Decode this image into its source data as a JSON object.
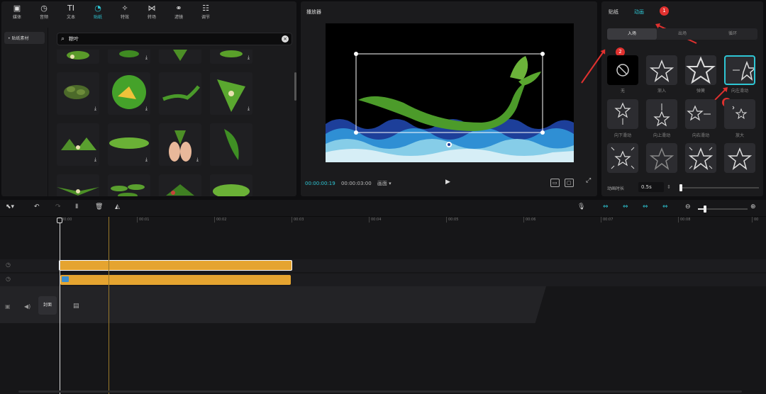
{
  "toolbar": {
    "items": [
      {
        "label": "媒体",
        "icon": "media-icon"
      },
      {
        "label": "音频",
        "icon": "audio-icon"
      },
      {
        "label": "文本",
        "icon": "text-icon"
      },
      {
        "label": "贴纸",
        "icon": "sticker-icon",
        "active": true
      },
      {
        "label": "特效",
        "icon": "effects-icon"
      },
      {
        "label": "转场",
        "icon": "transition-icon"
      },
      {
        "label": "滤镜",
        "icon": "filter-icon"
      },
      {
        "label": "调节",
        "icon": "adjust-icon"
      }
    ]
  },
  "sticker_panel": {
    "category": "• 贴纸素材",
    "search_value": "粽叶"
  },
  "player": {
    "title": "播放器",
    "current_time": "00:00:00:19",
    "total_time": "00:00:03:00",
    "ratio_label": "画面"
  },
  "right_panel": {
    "tabs": [
      "贴纸",
      "动画"
    ],
    "subtabs": [
      "入场",
      "出场",
      "循环"
    ],
    "animations": [
      "无",
      "渐入",
      "弹簧",
      "向左滑动",
      "向下滑动",
      "向上滑动",
      "向右滑动",
      "放大",
      "",
      "",
      "",
      ""
    ],
    "duration_label": "动画时长",
    "duration_value": "0.5s",
    "duration_fraction": 0.0,
    "badges": [
      "1",
      "2",
      "3"
    ]
  },
  "timeline": {
    "ruler": [
      "00:00",
      "00:01",
      "00:02",
      "00:03",
      "00:04",
      "00:05",
      "00:06",
      "00:07",
      "00:08",
      "00"
    ],
    "cover_label": "封面"
  },
  "colors": {
    "accent": "#2ec6d4",
    "clip": "#e5a430",
    "annotation": "#e0312f",
    "panel": "#1b1b1d"
  }
}
